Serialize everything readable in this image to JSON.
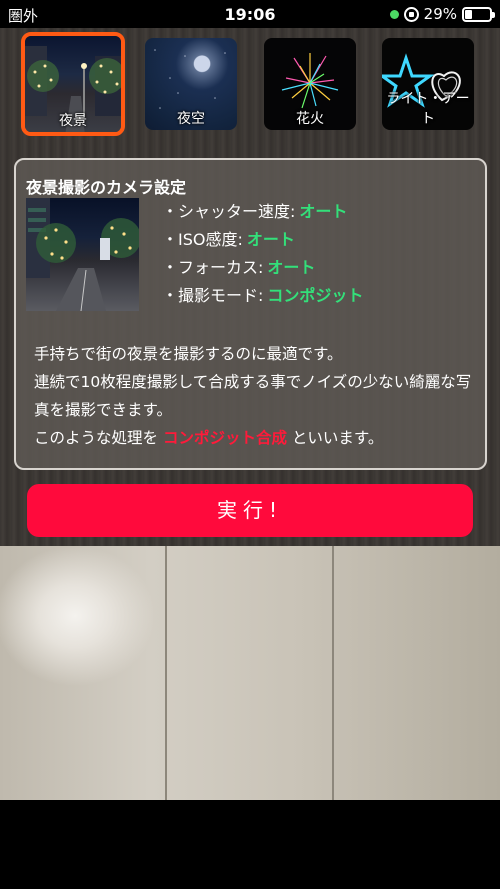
{
  "status": {
    "carrier": "圏外",
    "time": "19:06",
    "battery": "29%",
    "battery_level": 0.29,
    "indicator_color": "#4cd964"
  },
  "modes": [
    {
      "label": "夜景",
      "selected": true
    },
    {
      "label": "夜空",
      "selected": false
    },
    {
      "label": "花火",
      "selected": false
    },
    {
      "label": "ライト・アート",
      "selected": false
    }
  ],
  "panel": {
    "title": "夜景撮影のカメラ設定",
    "settings": [
      {
        "label": "・シャッター速度:",
        "value": "オート"
      },
      {
        "label": "・ISO感度:",
        "value": "オート"
      },
      {
        "label": "・フォーカス:",
        "value": "オート"
      },
      {
        "label": "・撮影モード:",
        "value": "コンポジット"
      }
    ],
    "desc_line1": "手持ちで街の夜景を撮影するのに最適です。",
    "desc_line2": "連続で10枚程度撮影して合成する事でノイズの少ない綺麗な写真を撮影できます。",
    "desc_line3_pre": "このような処理を",
    "desc_line3_highlight": "コンポジット合成",
    "desc_line3_post": "といいます。"
  },
  "execute_label": "実行!",
  "colors": {
    "accent_select": "#ff5a14",
    "execute": "#ff0a3c",
    "setting_value": "#33e07a",
    "highlight": "#ff1a3a"
  }
}
